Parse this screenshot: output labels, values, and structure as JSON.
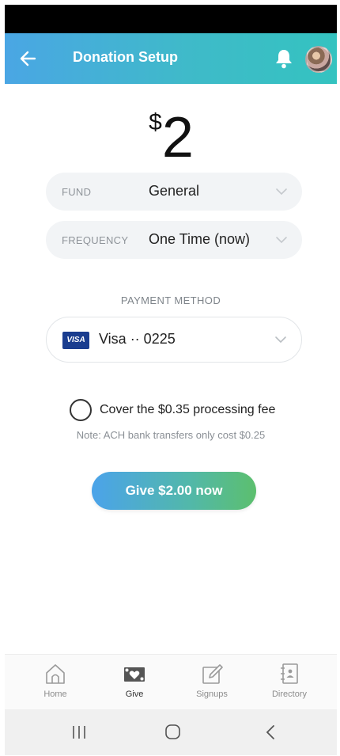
{
  "header": {
    "title": "Donation Setup",
    "back_icon": "arrow-left-icon",
    "bell_icon": "bell-icon"
  },
  "amount": {
    "currency": "$",
    "value": "2"
  },
  "fund": {
    "label": "FUND",
    "value": "General"
  },
  "frequency": {
    "label": "FREQUENCY",
    "value": "One Time (now)"
  },
  "payment": {
    "section_label": "PAYMENT METHOD",
    "card_brand": "VISA",
    "card_text": "Visa ·· 0225"
  },
  "fee": {
    "cover_label": "Cover the $0.35 processing fee",
    "note": "Note: ACH bank transfers only cost $0.25",
    "checked": false
  },
  "give_button": {
    "label": "Give $2.00 now"
  },
  "bottom_nav": {
    "items": [
      {
        "label": "Home",
        "icon": "home-icon"
      },
      {
        "label": "Give",
        "icon": "give-icon",
        "active": true
      },
      {
        "label": "Signups",
        "icon": "signups-icon"
      },
      {
        "label": "Directory",
        "icon": "directory-icon"
      }
    ]
  },
  "colors": {
    "header_start": "#4aa6e4",
    "header_end": "#34c3c0",
    "button_start": "#4ba3ea",
    "button_end": "#5cbf6e",
    "visa_blue": "#1a3d8f"
  }
}
